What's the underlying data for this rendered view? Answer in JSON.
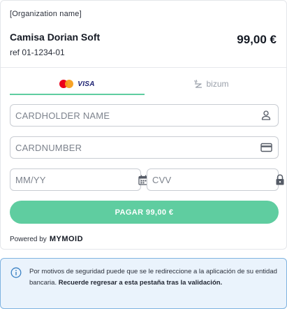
{
  "header": {
    "organization": "[Organization name]",
    "product_name": "Camisa Dorian Soft",
    "reference": "ref 01-1234-01",
    "amount": "99,00 €"
  },
  "tabs": [
    {
      "id": "cards",
      "label": "VISA",
      "active": true
    },
    {
      "id": "bizum",
      "label": "bizum",
      "active": false
    }
  ],
  "form": {
    "cardholder_placeholder": "CARDHOLDER NAME",
    "cardnumber_placeholder": "CARDNUMBER",
    "expiry_placeholder": "MM/YY",
    "cvv_placeholder": "CVV"
  },
  "pay_button": {
    "label": "PAGAR 99,00 €"
  },
  "footer": {
    "powered_by": "Powered by",
    "brand": "MYMOID"
  },
  "notice": {
    "text": "Por motivos de seguridad puede que se le redireccione a la aplicación de su entidad bancaria.",
    "bold_text": "Recuerde regresar a esta pestaña tras la validación."
  },
  "colors": {
    "accent": "#5fcda0",
    "notice_border": "#7fb3e0",
    "notice_bg": "#eaf3fc",
    "mastercard_red": "#eb001b",
    "mastercard_orange": "#f79e1b",
    "visa_blue": "#1a1f71"
  },
  "icons": {
    "cardholder": "user-icon",
    "cardnumber": "credit-card-icon",
    "expiry": "calendar-icon",
    "cvv": "lock-icon",
    "notice": "info-icon"
  }
}
